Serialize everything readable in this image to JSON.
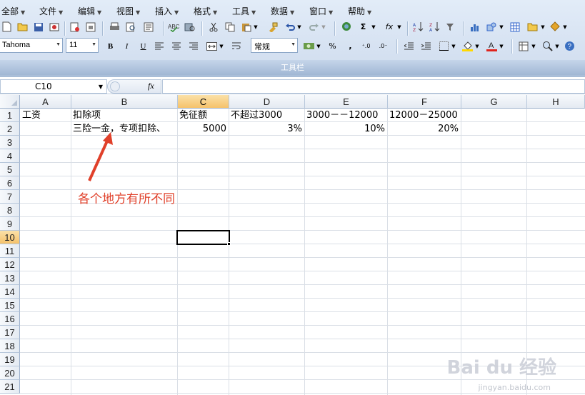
{
  "menubar": {
    "items": [
      "全部",
      "文件",
      "编辑",
      "视图",
      "插入",
      "格式",
      "工具",
      "数据",
      "窗口",
      "帮助"
    ]
  },
  "format_bar": {
    "font_name": "Tahoma",
    "font_size": "11",
    "number_format": "常规",
    "bold": "B",
    "italic": "I",
    "underline": "U",
    "percent": "%",
    "comma": ","
  },
  "toolbar_caption": "工具栏",
  "formula_bar": {
    "name_box": "C10",
    "fx_label": "fx",
    "content": ""
  },
  "sheet": {
    "columns": [
      "A",
      "B",
      "C",
      "D",
      "E",
      "F",
      "G",
      "H"
    ],
    "selected_column": "C",
    "rows": [
      "1",
      "2",
      "3",
      "4",
      "5",
      "6",
      "7",
      "8",
      "9",
      "10",
      "11",
      "12",
      "13",
      "14",
      "15",
      "16",
      "17",
      "18",
      "19",
      "20",
      "21"
    ],
    "selected_row": "10",
    "cells": {
      "A1": "工资",
      "B1": "扣除项",
      "C1": "免征额",
      "D1": "不超过3000",
      "E1": "3000－－12000",
      "F1": "12000－25000",
      "B2": "三险一金，专项扣除、",
      "C2": "5000",
      "D2": "3%",
      "E2": "10%",
      "F2": "20%"
    },
    "active_cell": "C10"
  },
  "annotation": {
    "text": "各个地方有所不同",
    "color": "#e0402a"
  },
  "watermark": {
    "brand": "Bai du 经验",
    "url": "jingyan.baidu.com"
  }
}
